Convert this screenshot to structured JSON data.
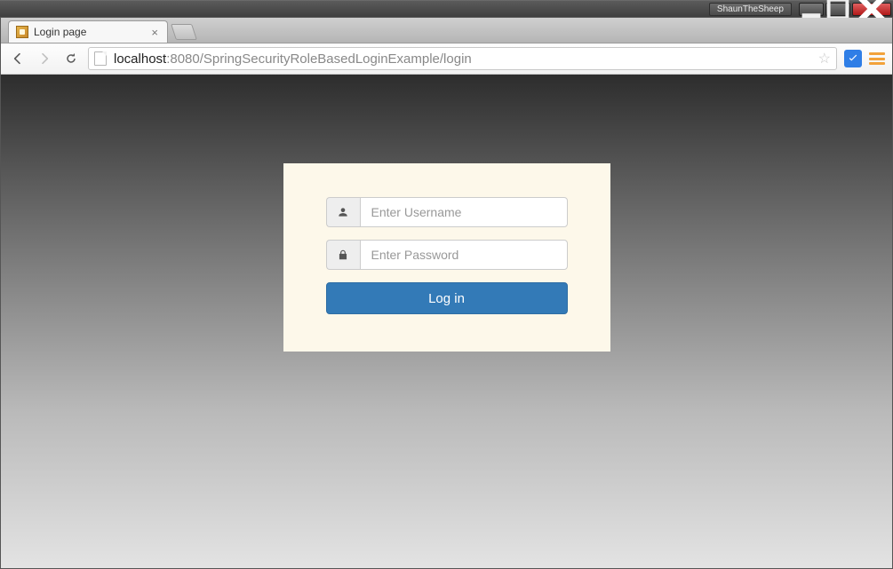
{
  "os": {
    "user_label": "ShaunTheSheep"
  },
  "browser": {
    "tab_title": "Login page",
    "url_host": "localhost",
    "url_port_path": ":8080/SpringSecurityRoleBasedLoginExample/login"
  },
  "login": {
    "username_placeholder": "Enter Username",
    "password_placeholder": "Enter Password",
    "submit_label": "Log in"
  }
}
